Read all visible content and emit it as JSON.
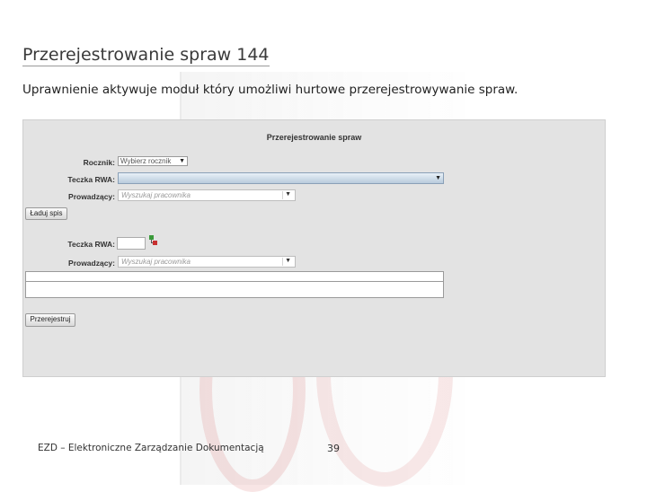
{
  "slide": {
    "title": "Przerejestrowanie spraw 144",
    "subtitle": "Uprawnienie aktywuje moduł który umożliwi hurtowe przerejestrowywanie spraw."
  },
  "panel": {
    "title": "Przerejestrowanie spraw",
    "section1": {
      "rocznik_label": "Rocznik:",
      "rocznik_value": "Wybierz rocznik",
      "teczka_label": "Teczka RWA:",
      "teczka_value": "",
      "prowadzacy_label": "Prowadzący:",
      "prowadzacy_placeholder": "Wyszukaj pracownika",
      "load_button": "Ładuj spis"
    },
    "section2": {
      "teczka_label": "Teczka RWA:",
      "prowadzacy_label": "Prowadzący:",
      "prowadzacy_placeholder": "Wyszukaj pracownika"
    },
    "register_button": "Przerejestruj"
  },
  "footer": {
    "text": "EZD – Elektroniczne Zarządzanie Dokumentacją",
    "page_number": "39"
  }
}
